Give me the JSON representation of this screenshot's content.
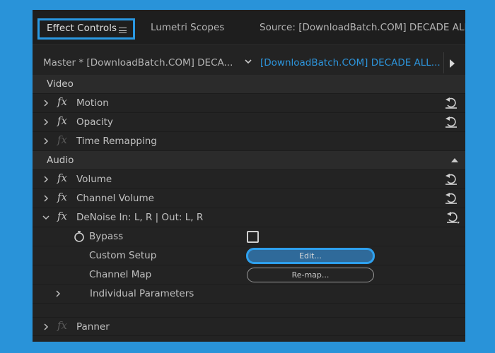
{
  "tabs": [
    {
      "label": "Effect Controls",
      "active": true
    },
    {
      "label": "Lumetri Scopes",
      "active": false
    },
    {
      "label": "Source: [DownloadBatch.COM]  DECADE ALL",
      "active": false
    }
  ],
  "clip_selector": {
    "master_label": "Master * [DownloadBatch.COM]  DECA...",
    "selected_clip": "[DownloadBatch.COM]  DECADE ALL..."
  },
  "sections": {
    "video_label": "Video",
    "audio_label": "Audio"
  },
  "video_effects": [
    {
      "label": "Motion"
    },
    {
      "label": "Opacity"
    },
    {
      "label": "Time Remapping"
    }
  ],
  "audio_effects": {
    "volume": "Volume",
    "channel_volume": "Channel Volume",
    "denoise": "DeNoise In: L, R | Out: L, R",
    "bypass": "Bypass",
    "custom_setup": "Custom Setup",
    "edit_button": "Edit...",
    "channel_map": "Channel Map",
    "remap_button": "Re-map...",
    "individual_parameters": "Individual Parameters",
    "panner": "Panner"
  },
  "fx_symbol": "fx",
  "colors": {
    "accent": "#2a98e2",
    "selected_clip": "#2d95dc",
    "panel_bg": "#232323",
    "page_bg": "#2993d9"
  },
  "icons": {
    "reset": "reset-icon",
    "collapse": "triangle-up-icon",
    "expand": "chevron-right-icon",
    "menu": "hamburger-icon"
  },
  "state": {
    "bypass_checked": false
  }
}
